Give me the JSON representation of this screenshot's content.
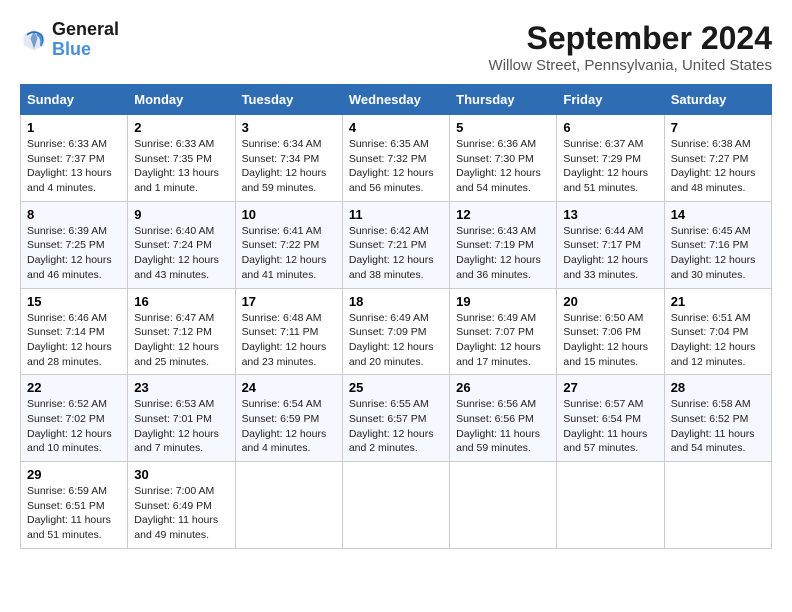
{
  "logo": {
    "text_general": "General",
    "text_blue": "Blue"
  },
  "header": {
    "title": "September 2024",
    "subtitle": "Willow Street, Pennsylvania, United States"
  },
  "days_of_week": [
    "Sunday",
    "Monday",
    "Tuesday",
    "Wednesday",
    "Thursday",
    "Friday",
    "Saturday"
  ],
  "weeks": [
    [
      {
        "day": "1",
        "sunrise": "6:33 AM",
        "sunset": "7:37 PM",
        "daylight": "13 hours and 4 minutes."
      },
      {
        "day": "2",
        "sunrise": "6:33 AM",
        "sunset": "7:35 PM",
        "daylight": "13 hours and 1 minute."
      },
      {
        "day": "3",
        "sunrise": "6:34 AM",
        "sunset": "7:34 PM",
        "daylight": "12 hours and 59 minutes."
      },
      {
        "day": "4",
        "sunrise": "6:35 AM",
        "sunset": "7:32 PM",
        "daylight": "12 hours and 56 minutes."
      },
      {
        "day": "5",
        "sunrise": "6:36 AM",
        "sunset": "7:30 PM",
        "daylight": "12 hours and 54 minutes."
      },
      {
        "day": "6",
        "sunrise": "6:37 AM",
        "sunset": "7:29 PM",
        "daylight": "12 hours and 51 minutes."
      },
      {
        "day": "7",
        "sunrise": "6:38 AM",
        "sunset": "7:27 PM",
        "daylight": "12 hours and 48 minutes."
      }
    ],
    [
      {
        "day": "8",
        "sunrise": "6:39 AM",
        "sunset": "7:25 PM",
        "daylight": "12 hours and 46 minutes."
      },
      {
        "day": "9",
        "sunrise": "6:40 AM",
        "sunset": "7:24 PM",
        "daylight": "12 hours and 43 minutes."
      },
      {
        "day": "10",
        "sunrise": "6:41 AM",
        "sunset": "7:22 PM",
        "daylight": "12 hours and 41 minutes."
      },
      {
        "day": "11",
        "sunrise": "6:42 AM",
        "sunset": "7:21 PM",
        "daylight": "12 hours and 38 minutes."
      },
      {
        "day": "12",
        "sunrise": "6:43 AM",
        "sunset": "7:19 PM",
        "daylight": "12 hours and 36 minutes."
      },
      {
        "day": "13",
        "sunrise": "6:44 AM",
        "sunset": "7:17 PM",
        "daylight": "12 hours and 33 minutes."
      },
      {
        "day": "14",
        "sunrise": "6:45 AM",
        "sunset": "7:16 PM",
        "daylight": "12 hours and 30 minutes."
      }
    ],
    [
      {
        "day": "15",
        "sunrise": "6:46 AM",
        "sunset": "7:14 PM",
        "daylight": "12 hours and 28 minutes."
      },
      {
        "day": "16",
        "sunrise": "6:47 AM",
        "sunset": "7:12 PM",
        "daylight": "12 hours and 25 minutes."
      },
      {
        "day": "17",
        "sunrise": "6:48 AM",
        "sunset": "7:11 PM",
        "daylight": "12 hours and 23 minutes."
      },
      {
        "day": "18",
        "sunrise": "6:49 AM",
        "sunset": "7:09 PM",
        "daylight": "12 hours and 20 minutes."
      },
      {
        "day": "19",
        "sunrise": "6:49 AM",
        "sunset": "7:07 PM",
        "daylight": "12 hours and 17 minutes."
      },
      {
        "day": "20",
        "sunrise": "6:50 AM",
        "sunset": "7:06 PM",
        "daylight": "12 hours and 15 minutes."
      },
      {
        "day": "21",
        "sunrise": "6:51 AM",
        "sunset": "7:04 PM",
        "daylight": "12 hours and 12 minutes."
      }
    ],
    [
      {
        "day": "22",
        "sunrise": "6:52 AM",
        "sunset": "7:02 PM",
        "daylight": "12 hours and 10 minutes."
      },
      {
        "day": "23",
        "sunrise": "6:53 AM",
        "sunset": "7:01 PM",
        "daylight": "12 hours and 7 minutes."
      },
      {
        "day": "24",
        "sunrise": "6:54 AM",
        "sunset": "6:59 PM",
        "daylight": "12 hours and 4 minutes."
      },
      {
        "day": "25",
        "sunrise": "6:55 AM",
        "sunset": "6:57 PM",
        "daylight": "12 hours and 2 minutes."
      },
      {
        "day": "26",
        "sunrise": "6:56 AM",
        "sunset": "6:56 PM",
        "daylight": "11 hours and 59 minutes."
      },
      {
        "day": "27",
        "sunrise": "6:57 AM",
        "sunset": "6:54 PM",
        "daylight": "11 hours and 57 minutes."
      },
      {
        "day": "28",
        "sunrise": "6:58 AM",
        "sunset": "6:52 PM",
        "daylight": "11 hours and 54 minutes."
      }
    ],
    [
      {
        "day": "29",
        "sunrise": "6:59 AM",
        "sunset": "6:51 PM",
        "daylight": "11 hours and 51 minutes."
      },
      {
        "day": "30",
        "sunrise": "7:00 AM",
        "sunset": "6:49 PM",
        "daylight": "11 hours and 49 minutes."
      },
      null,
      null,
      null,
      null,
      null
    ]
  ]
}
